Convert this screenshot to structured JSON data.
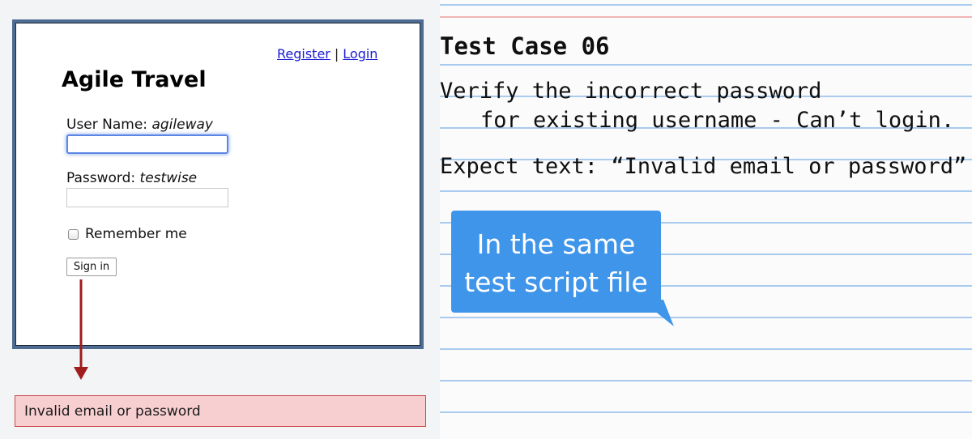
{
  "app": {
    "links": {
      "register": "Register",
      "separator": "|",
      "login": "Login"
    },
    "title": "Agile Travel",
    "username": {
      "label": "User Name:",
      "hint": "agileway",
      "value": ""
    },
    "password": {
      "label": "Password:",
      "hint": "testwise",
      "value": ""
    },
    "remember_label": "Remember me",
    "remember_checked": false,
    "signin_label": "Sign in",
    "error_message": "Invalid email or password"
  },
  "notes": {
    "title": "Test Case 06",
    "line1": "Verify the incorrect password",
    "line2": "for existing username - Can’t login.",
    "line3": "Expect text: “Invalid email or password”",
    "callout_line1": "In the same",
    "callout_line2": "test script file"
  },
  "colors": {
    "frame": "#4e6c92",
    "link": "#1a1ad6",
    "error_bg": "#f8cfd0",
    "error_border": "#c9474c",
    "arrow": "#a11c1c",
    "callout": "#3f95ea",
    "rule_line": "#a9cbef",
    "margin_line": "#f0b4b4"
  }
}
